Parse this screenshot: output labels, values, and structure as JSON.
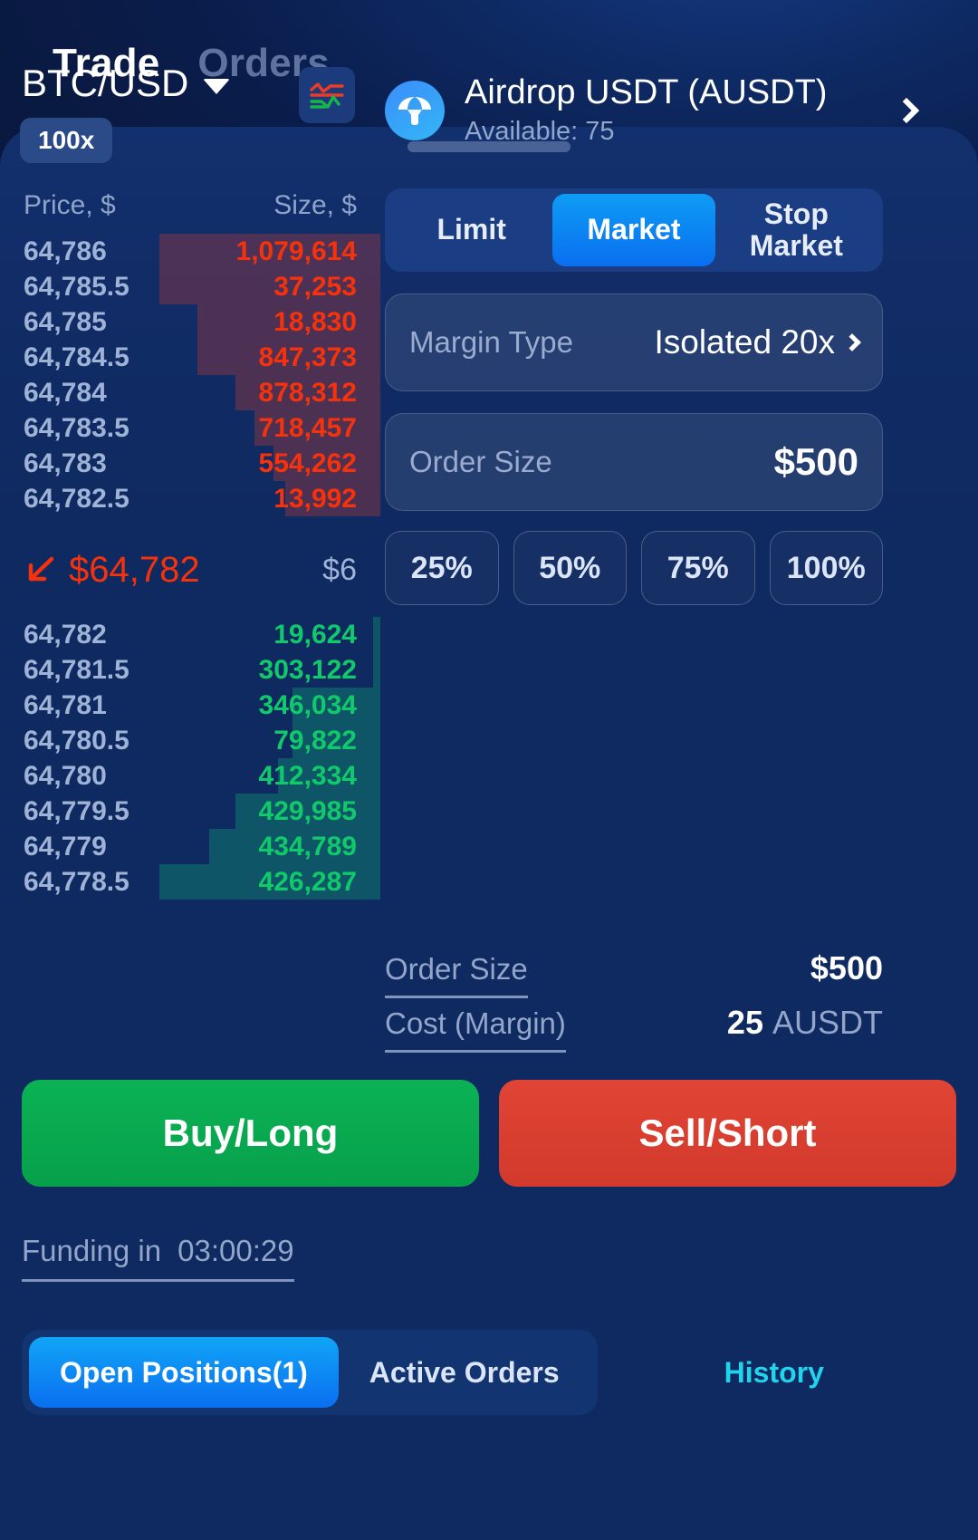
{
  "topbar": {
    "tabs": [
      {
        "label": "Trade",
        "active": true
      },
      {
        "label": "Orders",
        "active": false
      }
    ]
  },
  "pair": {
    "symbol": "BTC/USD",
    "leverage": "100x",
    "chart_icon": "candlestick-chart-icon",
    "dropdown_icon": "chevron-down-icon"
  },
  "token": {
    "icon": "airdrop-parachute-icon",
    "name": "Airdrop USDT (AUSDT)",
    "available": "Available: 75",
    "chevron": "chevron-right-icon"
  },
  "orderbook": {
    "col_price": "Price, $",
    "col_size": "Size, $",
    "asks": [
      {
        "price": "64,786",
        "size": "1,079,614",
        "depth": 58
      },
      {
        "price": "64,785.5",
        "size": "37,253",
        "depth": 58
      },
      {
        "price": "64,785",
        "size": "18,830",
        "depth": 48
      },
      {
        "price": "64,784.5",
        "size": "847,373",
        "depth": 48
      },
      {
        "price": "64,784",
        "size": "878,312",
        "depth": 38
      },
      {
        "price": "64,783.5",
        "size": "718,457",
        "depth": 33
      },
      {
        "price": "64,783",
        "size": "554,262",
        "depth": 28
      },
      {
        "price": "64,782.5",
        "size": "13,992",
        "depth": 25
      }
    ],
    "bids": [
      {
        "price": "64,782",
        "size": "19,624",
        "depth": 2
      },
      {
        "price": "64,781.5",
        "size": "303,122",
        "depth": 2
      },
      {
        "price": "64,781",
        "size": "346,034",
        "depth": 23
      },
      {
        "price": "64,780.5",
        "size": "79,822",
        "depth": 23
      },
      {
        "price": "64,780",
        "size": "412,334",
        "depth": 27
      },
      {
        "price": "64,779.5",
        "size": "429,985",
        "depth": 38
      },
      {
        "price": "64,779",
        "size": "434,789",
        "depth": 45
      },
      {
        "price": "64,778.5",
        "size": "426,287",
        "depth": 58
      }
    ],
    "last_price": "$64,782",
    "last_trend_icon": "arrow-down-left-icon",
    "spread_value": "$6"
  },
  "order_form": {
    "types": [
      {
        "label": "Limit",
        "selected": false
      },
      {
        "label": "Market",
        "selected": true
      },
      {
        "label": "Stop Market",
        "selected": false
      }
    ],
    "margin_label": "Margin Type",
    "margin_value": "Isolated 20x",
    "size_label": "Order Size",
    "size_value": "$500",
    "percents": [
      "25%",
      "50%",
      "75%",
      "100%"
    ]
  },
  "summary": {
    "order_size_label": "Order Size",
    "order_size_value": "$500",
    "cost_label": "Cost (Margin)",
    "cost_value": "25",
    "cost_unit": "AUSDT"
  },
  "actions": {
    "buy": "Buy/Long",
    "sell": "Sell/Short"
  },
  "funding": {
    "label": "Funding in",
    "timer": "03:00:29"
  },
  "bottom_tabs": {
    "items": [
      {
        "label": "Open Positions(1)",
        "selected": true
      },
      {
        "label": "Active Orders",
        "selected": false
      }
    ],
    "history": "History"
  },
  "colors": {
    "ask": "#f6320c",
    "bid": "#10c96a",
    "accent": "#0a6ff0",
    "buy": "#07a04b",
    "sell": "#d23a2c",
    "history": "#22d3ee"
  }
}
